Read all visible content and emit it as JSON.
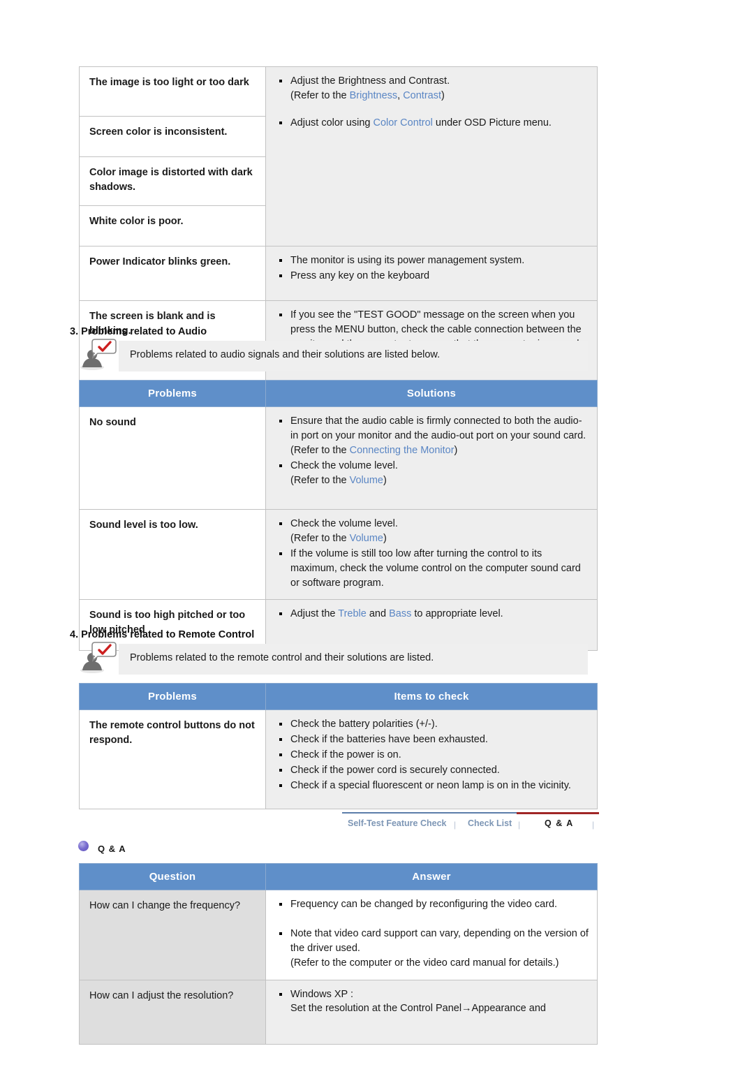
{
  "tables": {
    "video_continued": {
      "rows": [
        {
          "problem": "The image is too light or too dark",
          "solutions": [
            {
              "text": "Adjust the Brightness and Contrast.",
              "sub": "(Refer to the Brightness, Contrast)"
            }
          ]
        },
        {
          "problem": "Screen color is inconsistent.",
          "solutions": [
            {
              "text": "Adjust color using Color Control under OSD Picture menu."
            }
          ]
        },
        {
          "problem": "Color image is distorted with dark shadows.",
          "solutions": []
        },
        {
          "problem": "White color is poor.",
          "solutions": []
        },
        {
          "problem": "Power Indicator blinks green.",
          "solutions": [
            {
              "text": "The monitor is using its power management system."
            },
            {
              "text": "Press any key on the keyboard"
            }
          ]
        },
        {
          "problem": "The screen is blank and is blinking.",
          "solutions": [
            {
              "text": "If you see the \"TEST GOOD\" message on the screen when you press the MENU button, check the cable connection between the monitor and the computer to ensure that the connector is properly connected."
            }
          ]
        }
      ]
    },
    "audio": {
      "section_number": "3.",
      "section_title": "3. Problems related to Audio",
      "note": "Problems related to audio signals and their solutions are listed below.",
      "note_icon": "person-with-checkmark-bubble-icon",
      "headers": {
        "left": "Problems",
        "right": "Solutions"
      },
      "rows": [
        {
          "problem": "No sound",
          "solutions": [
            {
              "text": "Ensure that the audio cable is firmly connected to both the audio-in port on your monitor and the audio-out port on your sound card.",
              "sub": "(Refer to the Connecting the Monitor)"
            },
            {
              "text": "Check the volume level.",
              "sub": "(Refer to the Volume)"
            }
          ]
        },
        {
          "problem": "Sound level is too low.",
          "solutions": [
            {
              "text": "Check the volume level.",
              "sub": "(Refer to the Volume)"
            },
            {
              "text": "If the volume is still too low after turning the control to its maximum, check the volume control on the computer sound card or software program."
            }
          ]
        },
        {
          "problem": "Sound is too high pitched or too low pitched",
          "solutions": [
            {
              "text": "Adjust the Treble and Bass to appropriate level."
            }
          ]
        }
      ]
    },
    "remote": {
      "section_title": "4. Problems related to Remote Control",
      "note": "Problems related to the remote control and their solutions are listed.",
      "note_icon": "person-with-checkmark-bubble-icon",
      "headers": {
        "left": "Problems",
        "right": "Items to check"
      },
      "rows": [
        {
          "problem": "The remote control buttons do not respond.",
          "solutions": [
            {
              "text": "Check the battery polarities (+/-)."
            },
            {
              "text": "Check if the batteries have been exhausted."
            },
            {
              "text": "Check if the power is on."
            },
            {
              "text": "Check if the power cord is securely connected."
            },
            {
              "text": "Check if a special fluorescent or neon lamp is on in the vicinity."
            }
          ]
        }
      ]
    },
    "qa": {
      "label": "Q & A",
      "headers": {
        "left": "Question",
        "right": "Answer"
      },
      "rows": [
        {
          "question": "How can I change the frequency?",
          "answers": [
            {
              "text": "Frequency can be changed by reconfiguring the video card."
            },
            {
              "text": "Note that video card support can vary, depending on the version of the driver used.",
              "sub": "(Refer to the computer or the video card manual for details.)"
            }
          ]
        },
        {
          "question": "How can I adjust the resolution?",
          "answers": [
            {
              "text": "Windows XP :",
              "sub": "Set the resolution at the Control Panel→Appearance and"
            }
          ]
        }
      ]
    }
  },
  "tabs": {
    "items": [
      {
        "label": "Self-Test Feature Check",
        "active": false
      },
      {
        "label": "Check List",
        "active": false
      },
      {
        "label": "Q & A",
        "active": true
      }
    ],
    "separator": "|"
  },
  "links": [
    "Brightness",
    "Contrast",
    "Color Control",
    "Connecting the Monitor",
    "Volume",
    "Treble",
    "Bass"
  ],
  "colors": {
    "header_blue": "#5f8fc9",
    "link_blue": "#5a86c4",
    "cell_gray": "#eeeeee",
    "question_gray": "#dedede",
    "tab_active_rule": "#a02626",
    "tab_inactive_text": "#7d96b5"
  }
}
